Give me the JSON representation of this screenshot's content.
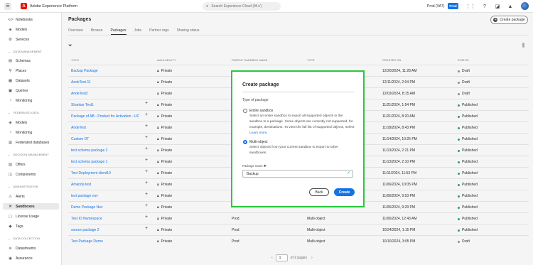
{
  "topbar": {
    "app_title": "Adobe Experience Platform",
    "search_placeholder": "Search Experience Cloud (⌘+/)",
    "org_name": "Prod (VA7)",
    "sandbox_badge": "Prod"
  },
  "sidebar": {
    "items_top": [
      {
        "label": "Notebooks",
        "icon": "code-icon"
      },
      {
        "label": "Models",
        "icon": "models-icon"
      },
      {
        "label": "Services",
        "icon": "services-icon"
      }
    ],
    "sections": [
      {
        "header": "DATA MANAGEMENT",
        "items": [
          {
            "label": "Schemas",
            "icon": "schema-icon"
          },
          {
            "label": "Places",
            "icon": "pin-icon"
          },
          {
            "label": "Datasets",
            "icon": "dataset-icon"
          },
          {
            "label": "Queries",
            "icon": "query-icon"
          },
          {
            "label": "Monitoring",
            "icon": "monitoring-icon"
          }
        ]
      },
      {
        "header": "FEDERATED DATA",
        "items": [
          {
            "label": "Models",
            "icon": "models-icon"
          },
          {
            "label": "Monitoring",
            "icon": "monitoring-icon"
          },
          {
            "label": "Federated databases",
            "icon": "database-icon"
          }
        ]
      },
      {
        "header": "DECISION MANAGEMENT",
        "items": [
          {
            "label": "Offers",
            "icon": "offers-icon"
          },
          {
            "label": "Components",
            "icon": "components-icon"
          }
        ]
      },
      {
        "header": "ADMINISTRATION",
        "items": [
          {
            "label": "Alerts",
            "icon": "alert-icon"
          },
          {
            "label": "Sandboxes",
            "icon": "sandbox-icon"
          },
          {
            "label": "License Usage",
            "icon": "license-icon"
          },
          {
            "label": "Tags",
            "icon": "tag-icon"
          }
        ]
      },
      {
        "header": "DATA COLLECTION",
        "items": [
          {
            "label": "Datastreams",
            "icon": "datastream-icon"
          },
          {
            "label": "Assurance",
            "icon": "assurance-icon"
          }
        ]
      }
    ]
  },
  "page": {
    "title": "Packages",
    "create_button": "Create package",
    "tabs": [
      "Overview",
      "Browse",
      "Packages",
      "Jobs",
      "Partner orgs",
      "Sharing status"
    ],
    "selected_tab": "Packages"
  },
  "table": {
    "headers": [
      "TITLE",
      "AVAILABILITY",
      "PARENT SANDBOX NAME",
      "TYPE",
      "CREATED ON",
      "STATUS"
    ],
    "rows": [
      {
        "title": "Backup Package",
        "plus": false,
        "availability": "Private",
        "parent": "",
        "type": "",
        "created": "12/20/2024, 11:28 AM",
        "status": "Draft"
      },
      {
        "title": "AndeTest-11",
        "plus": false,
        "availability": "Private",
        "parent": "",
        "type": "",
        "created": "12/11/2024, 2:04 PM",
        "status": "Draft"
      },
      {
        "title": "AndeTest2",
        "plus": false,
        "availability": "Private",
        "parent": "",
        "type": "",
        "created": "12/03/2024, 8:15 AM",
        "status": "Draft"
      },
      {
        "title": "Shankar Test1",
        "plus": true,
        "availability": "Private",
        "parent": "",
        "type": "",
        "created": "11/21/2024, 1:54 PM",
        "status": "Published"
      },
      {
        "title": "Package of AB - Product for Activation - UC",
        "plus": true,
        "availability": "Private",
        "parent": "",
        "type": "",
        "created": "11/21/2024, 8:20 AM",
        "status": "Published"
      },
      {
        "title": "AndeTest",
        "plus": true,
        "availability": "Private",
        "parent": "",
        "type": "",
        "created": "11/18/2024, 8:43 PM",
        "status": "Published"
      },
      {
        "title": "Custom DT",
        "plus": true,
        "availability": "Private",
        "parent": "",
        "type": "",
        "created": "11/14/2024, 10:25 PM",
        "status": "Published"
      },
      {
        "title": "test schema package 2",
        "plus": true,
        "availability": "Private",
        "parent": "",
        "type": "",
        "created": "11/13/2024, 2:21 PM",
        "status": "Published"
      },
      {
        "title": "test schema package 1",
        "plus": true,
        "availability": "Private",
        "parent": "",
        "type": "",
        "created": "11/13/2024, 2:10 PM",
        "status": "Published"
      },
      {
        "title": "Test Deployment client10",
        "plus": true,
        "availability": "Private",
        "parent": "",
        "type": "",
        "created": "11/11/2024, 11:53 PM",
        "status": "Published"
      },
      {
        "title": "Amanda test",
        "plus": true,
        "availability": "Private",
        "parent": "",
        "type": "",
        "created": "11/06/2024, 10:05 PM",
        "status": "Published"
      },
      {
        "title": "test package nov",
        "plus": true,
        "availability": "Private",
        "parent": "",
        "type": "",
        "created": "11/06/2024, 9:53 PM",
        "status": "Published"
      },
      {
        "title": "Demo Package Nov",
        "plus": true,
        "availability": "Private",
        "parent": "",
        "type": "",
        "created": "11/06/2024, 9:29 PM",
        "status": "Published"
      },
      {
        "title": "Test ID Namespace",
        "plus": true,
        "availability": "Private",
        "parent": "Prod",
        "type": "Multi-object",
        "created": "11/06/2024, 12:43 AM",
        "status": "Published"
      },
      {
        "title": "source package 2",
        "plus": true,
        "availability": "Private",
        "parent": "Prod",
        "type": "Multi-object",
        "created": "10/24/2024, 1:15 PM",
        "status": "Published"
      },
      {
        "title": "Test Package Demo",
        "plus": false,
        "availability": "Private",
        "parent": "Prod",
        "type": "Multi-object",
        "created": "10/10/2024, 3:05 PM",
        "status": "Draft"
      }
    ]
  },
  "pagination": {
    "page": "1",
    "total_label": "of 2 pages"
  },
  "modal": {
    "title": "Create package",
    "type_label": "Type of package",
    "option1_label": "Entire sandbox",
    "option1_desc": "Select an entire sandbox to export all supported objects in the sandbox to a package. Some objects are currently not supported, for example, destinations. To view the full list of supported objects, select",
    "option1_link": "Learn more.",
    "option2_label": "Multi-object",
    "option2_desc": "Select objects from your current sandbox to export to other sandboxes.",
    "name_label": "Package name ✱",
    "name_value": "Backup",
    "back_label": "Back",
    "create_label": "Create"
  },
  "colors": {
    "accent": "#1473e6",
    "highlight_border": "#28c83c",
    "published": "#2d9d78",
    "draft": "#8e8e8e"
  }
}
